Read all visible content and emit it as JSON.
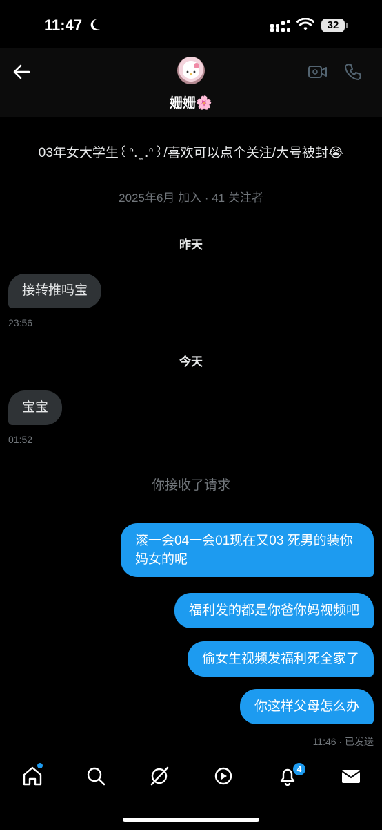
{
  "status_bar": {
    "time": "11:47",
    "battery": "32"
  },
  "header": {
    "name": "姗姗🌸"
  },
  "profile": {
    "bio": "03年女大学生꒰ᐢ. ̫ .ᐢ꒱/喜欢可以点个关注/大号被封😭",
    "joined": "2025年6月 加入 · 41 关注者"
  },
  "conversation": {
    "yesterday_label": "昨天",
    "msg1": {
      "text": "接转推吗宝",
      "time": "23:56"
    },
    "today_label": "今天",
    "msg2": {
      "text": "宝宝",
      "time": "01:52"
    },
    "accepted_notice": "你接收了请求",
    "out1": "滚一会04一会01现在又03 死男的装你妈女的呢",
    "out2": "福利发的都是你爸你妈视频吧",
    "out3": "偷女生视频发福利死全家了",
    "out4": "你这样父母怎么办",
    "sent_status": "11:46 · 已发送"
  },
  "nav": {
    "notifications_badge": "4"
  },
  "colors": {
    "accent": "#1d9bf0",
    "incoming_bubble": "#2f3336",
    "background": "#000000"
  }
}
